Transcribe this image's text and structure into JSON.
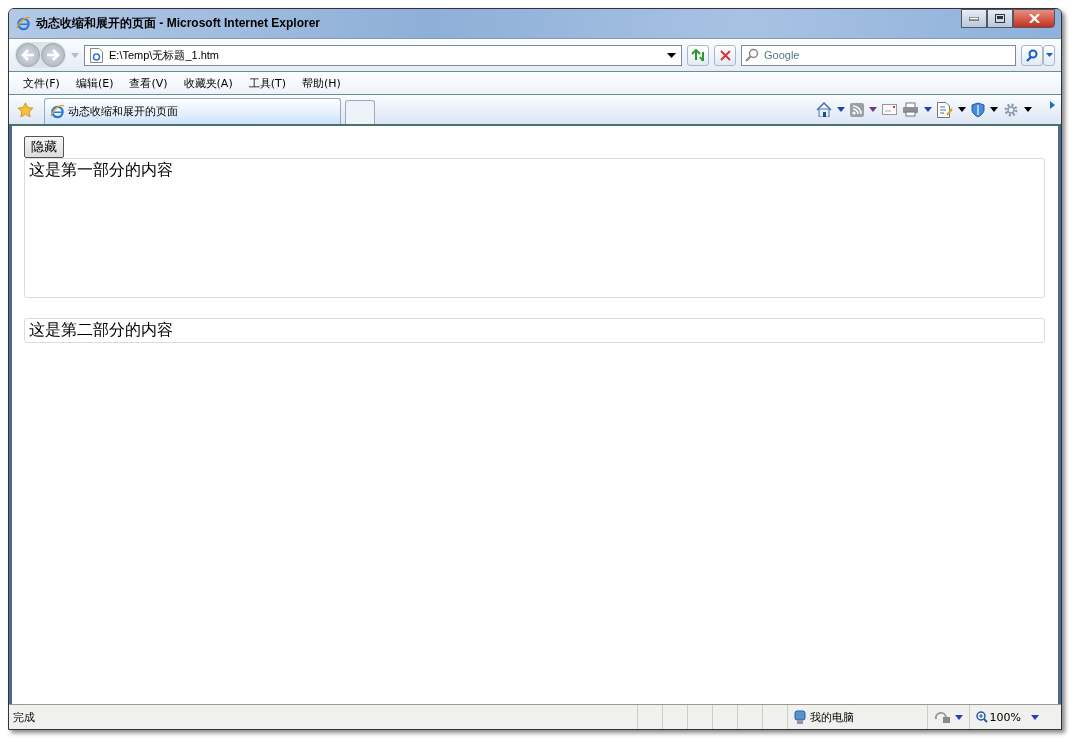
{
  "window": {
    "title": "动态收缩和展开的页面 - Microsoft Internet Explorer"
  },
  "address_bar": {
    "value": "E:\\Temp\\无标题_1.htm"
  },
  "search": {
    "placeholder": "Google"
  },
  "menu": [
    "文件(F)",
    "编辑(E)",
    "查看(V)",
    "收藏夹(A)",
    "工具(T)",
    "帮助(H)"
  ],
  "tabs": [
    {
      "label": "动态收缩和展开的页面",
      "selected": true
    }
  ],
  "page": {
    "button": "隐藏",
    "sections": [
      {
        "text": "这是第一部分的内容"
      },
      {
        "text": "这是第二部分的内容"
      }
    ]
  },
  "status_bar": {
    "status": "完成",
    "zone": "我的电脑",
    "zoom": "100%"
  }
}
